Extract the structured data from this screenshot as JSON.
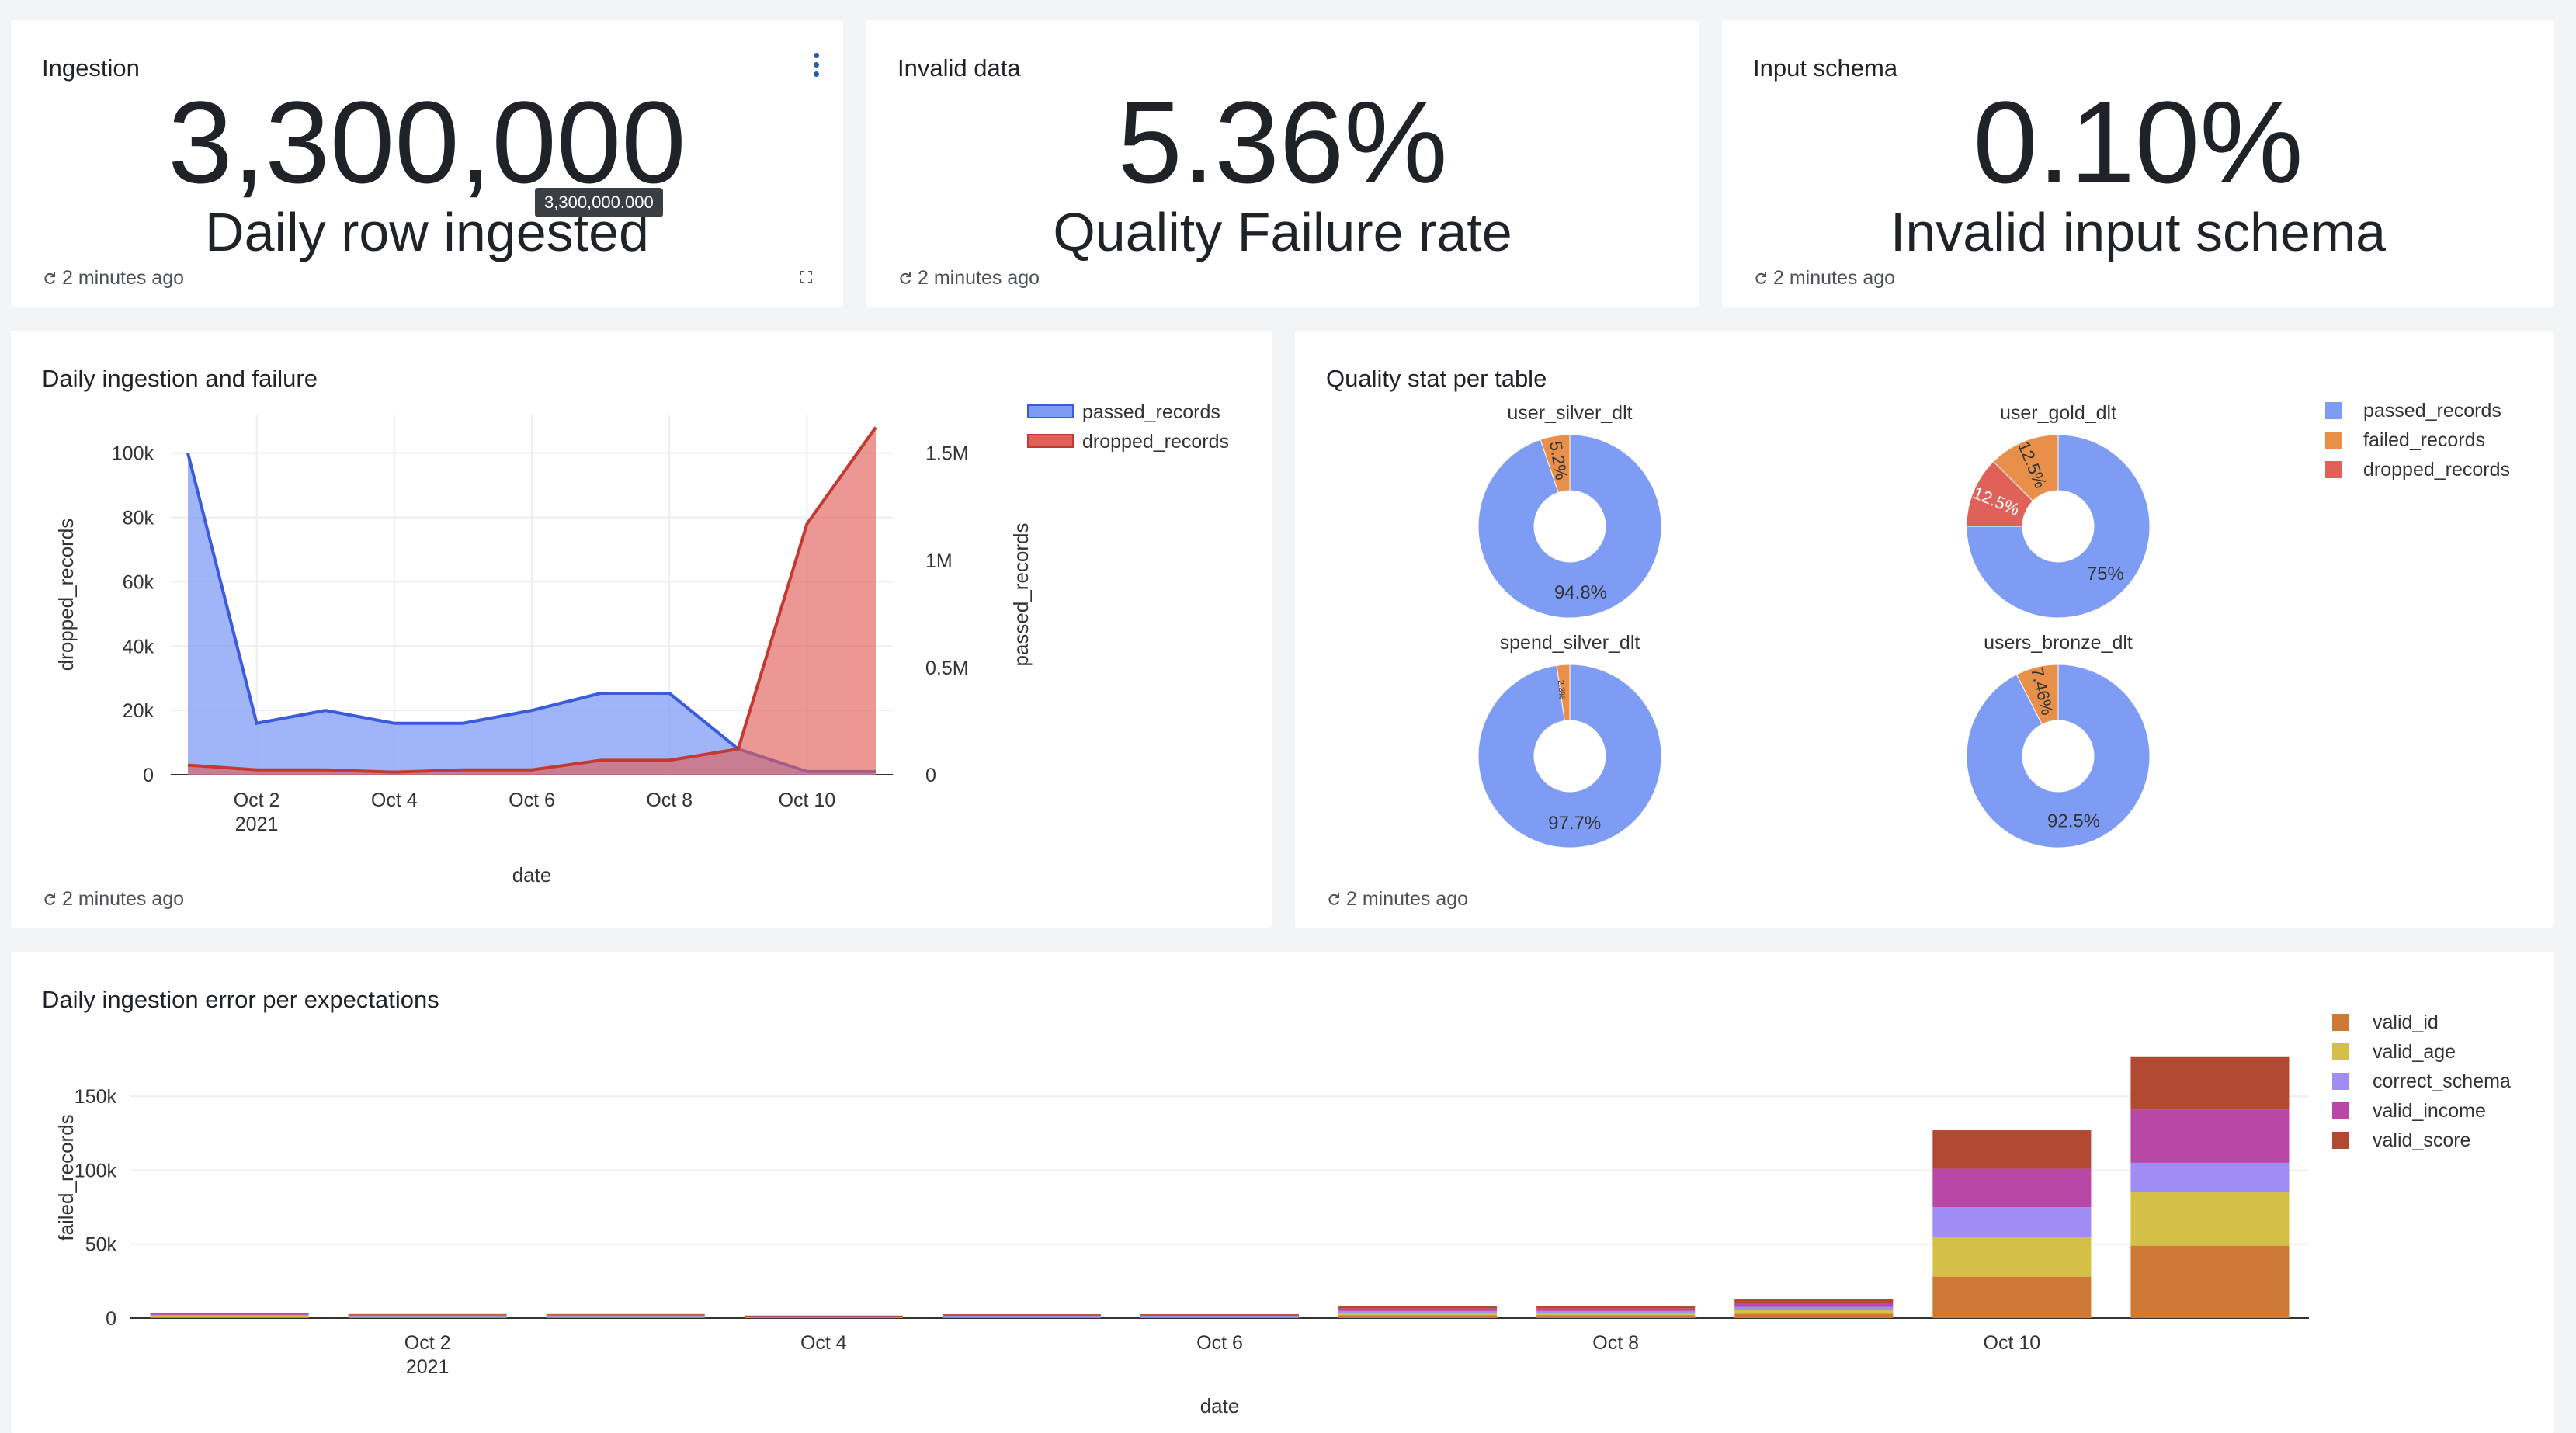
{
  "counters": [
    {
      "title": "Ingestion",
      "value": "3,300,000",
      "label": "Daily row ingested",
      "refresh": "2 minutes ago",
      "tooltip": "3,300,000.000"
    },
    {
      "title": "Invalid data",
      "value": "5.36%",
      "label": "Quality Failure rate",
      "refresh": "2 minutes ago"
    },
    {
      "title": "Input schema",
      "value": "0.10%",
      "label": "Invalid input schema",
      "refresh": "2 minutes ago"
    }
  ],
  "line_panel": {
    "title": "Daily ingestion and failure",
    "refresh": "2 minutes ago"
  },
  "pie_panel": {
    "title": "Quality stat per table",
    "refresh": "2 minutes ago"
  },
  "bar_panel": {
    "title": "Daily ingestion error per expectations"
  },
  "colors": {
    "passed": "#7f9cf5",
    "passed_line": "#3b5bdb",
    "dropped": "#e0605a",
    "dropped_line": "#c23a32",
    "failed": "#e8904a",
    "valid_id": "#cc7a35",
    "valid_age": "#d4c046",
    "correct_schema": "#a08cf5",
    "valid_income": "#b947a5",
    "valid_score": "#b24a33"
  },
  "chart_data": [
    {
      "type": "area",
      "xlabel": "date",
      "x": [
        "2021-10-01",
        "2021-10-02",
        "2021-10-03",
        "2021-10-04",
        "2021-10-05",
        "2021-10-06",
        "2021-10-07",
        "2021-10-08",
        "2021-10-09",
        "2021-10-10",
        "2021-10-11"
      ],
      "x_ticks": [
        {
          "label": "Oct 2",
          "sub": "2021",
          "at": "2021-10-02"
        },
        {
          "label": "Oct 4",
          "at": "2021-10-04"
        },
        {
          "label": "Oct 6",
          "at": "2021-10-06"
        },
        {
          "label": "Oct 8",
          "at": "2021-10-08"
        },
        {
          "label": "Oct 10",
          "at": "2021-10-10"
        }
      ],
      "y_left": {
        "label": "dropped_records",
        "range": [
          0,
          112000
        ],
        "ticks": [
          0,
          20000,
          40000,
          60000,
          80000,
          100000
        ],
        "tick_labels": [
          "0",
          "20k",
          "40k",
          "60k",
          "80k",
          "100k"
        ]
      },
      "y_right": {
        "label": "passed_records",
        "range": [
          0,
          1680000
        ],
        "ticks": [
          0,
          500000,
          1000000,
          1500000
        ],
        "tick_labels": [
          "0",
          "0.5M",
          "1M",
          "1.5M"
        ]
      },
      "grid": true,
      "legend": "top-right",
      "series": [
        {
          "name": "passed_records",
          "axis": "right",
          "values": [
            1500000,
            240000,
            300000,
            240000,
            240000,
            300000,
            380000,
            380000,
            120000,
            15000,
            15000
          ]
        },
        {
          "name": "dropped_records",
          "axis": "left",
          "values": [
            3000,
            1500,
            1500,
            800,
            1500,
            1500,
            4500,
            4500,
            8000,
            78000,
            108000
          ]
        }
      ]
    },
    {
      "type": "pie",
      "legend": "top-right",
      "legend_entries": [
        "passed_records",
        "failed_records",
        "dropped_records"
      ],
      "pies": [
        {
          "name": "user_silver_dlt",
          "slices": [
            {
              "label": "passed_records",
              "value": 94.8,
              "text": "94.8%"
            },
            {
              "label": "failed_records",
              "value": 5.2,
              "text": "5.2%"
            }
          ]
        },
        {
          "name": "user_gold_dlt",
          "slices": [
            {
              "label": "passed_records",
              "value": 75,
              "text": "75%"
            },
            {
              "label": "dropped_records",
              "value": 12.5,
              "text": "12.5%"
            },
            {
              "label": "failed_records",
              "value": 12.5,
              "text": "12.5%"
            }
          ]
        },
        {
          "name": "spend_silver_dlt",
          "slices": [
            {
              "label": "passed_records",
              "value": 97.7,
              "text": "97.7%"
            },
            {
              "label": "failed_records",
              "value": 2.3,
              "text": "2.3%"
            }
          ]
        },
        {
          "name": "users_bronze_dlt",
          "slices": [
            {
              "label": "passed_records",
              "value": 92.5,
              "text": "92.5%"
            },
            {
              "label": "failed_records",
              "value": 7.5,
              "text": "7.46%"
            }
          ]
        }
      ]
    },
    {
      "type": "bar",
      "stacked": true,
      "xlabel": "date",
      "ylabel": "failed_records",
      "ylim": [
        0,
        190000
      ],
      "y_ticks": [
        0,
        50000,
        100000,
        150000
      ],
      "y_tick_labels": [
        "0",
        "50k",
        "100k",
        "150k"
      ],
      "categories": [
        "2021-10-01",
        "2021-10-02",
        "2021-10-03",
        "2021-10-04",
        "2021-10-05",
        "2021-10-06",
        "2021-10-07",
        "2021-10-08",
        "2021-10-09",
        "2021-10-10",
        "2021-10-11"
      ],
      "x_ticks": [
        {
          "label": "Oct 2",
          "sub": "2021",
          "at": 1
        },
        {
          "label": "Oct 4",
          "at": 3
        },
        {
          "label": "Oct 6",
          "at": 5
        },
        {
          "label": "Oct 8",
          "at": 7
        },
        {
          "label": "Oct 10",
          "at": 9
        }
      ],
      "legend": "top-right",
      "series": [
        {
          "name": "valid_id",
          "values": [
            1000,
            800,
            800,
            500,
            700,
            700,
            2000,
            2000,
            3000,
            28000,
            49000
          ]
        },
        {
          "name": "valid_age",
          "values": [
            800,
            600,
            600,
            400,
            600,
            600,
            1700,
            1700,
            2600,
            27000,
            36000
          ]
        },
        {
          "name": "correct_schema",
          "values": [
            400,
            300,
            300,
            200,
            300,
            300,
            1100,
            1100,
            2000,
            20000,
            20000
          ]
        },
        {
          "name": "valid_income",
          "values": [
            700,
            500,
            500,
            300,
            500,
            500,
            1700,
            1700,
            2700,
            26000,
            36000
          ]
        },
        {
          "name": "valid_score",
          "values": [
            600,
            500,
            500,
            300,
            500,
            500,
            1600,
            1600,
            2500,
            26000,
            36000
          ]
        }
      ]
    }
  ]
}
